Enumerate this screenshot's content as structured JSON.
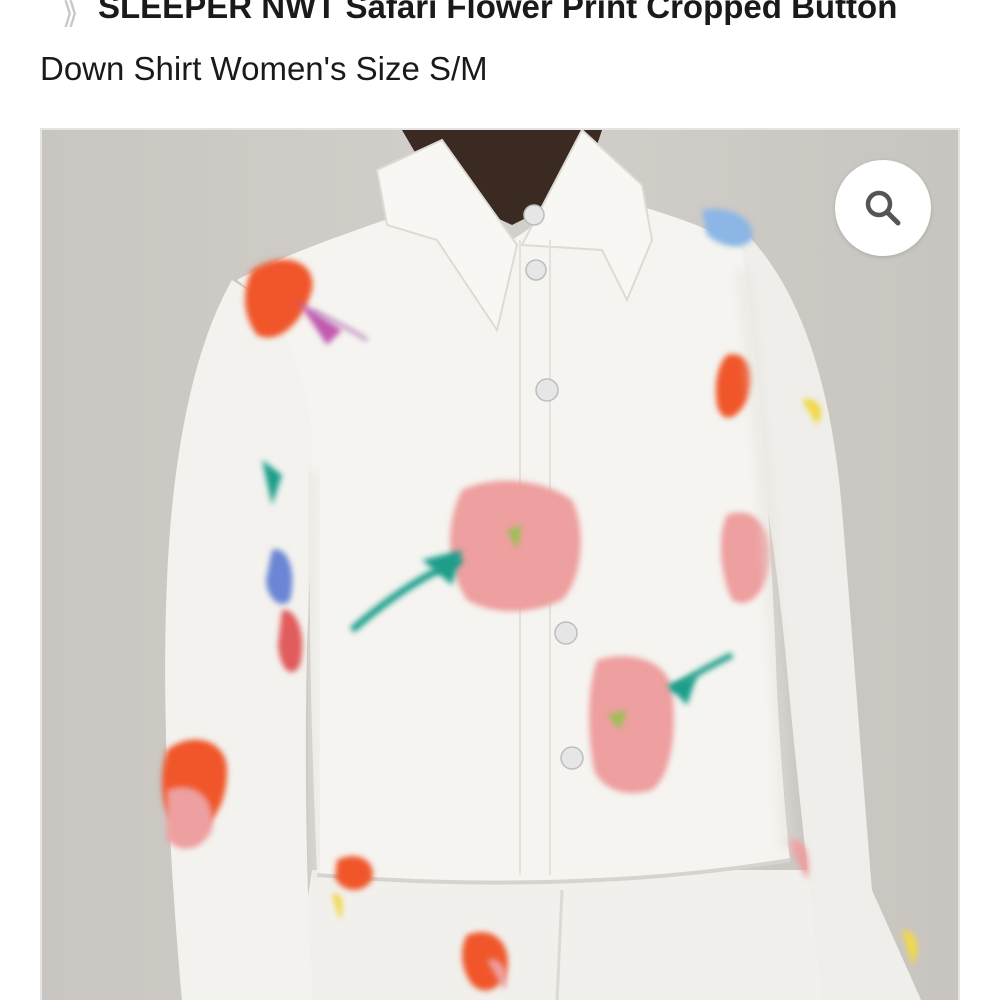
{
  "product": {
    "title_line1": "SLEEPER NWT Safari Flower Print Cropped Button",
    "title_line2": "Down Shirt Women's Size S/M"
  },
  "breadcrumb": {
    "separator_icon": "double-chevron-right-icon"
  },
  "gallery": {
    "image_subject": "white cropped button-down shirt with watercolor flower print",
    "zoom_icon": "search-icon"
  },
  "colors": {
    "background": "#ffffff",
    "photo_backdrop": "#ccc8c3",
    "shirt": "#f4f3ef",
    "pink_flower": "#ee9f9f",
    "orange_flower": "#f0562a",
    "teal_stem": "#1f9e8a",
    "zoom_icon": "#555555"
  }
}
